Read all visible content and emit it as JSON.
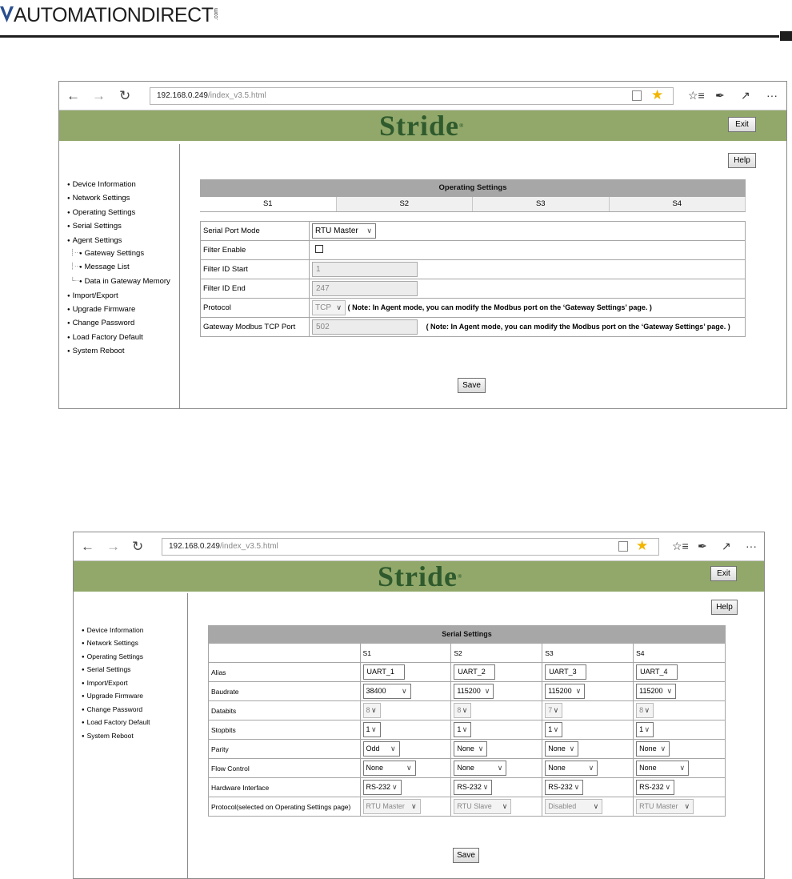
{
  "logo": {
    "text": "AUTOMATIONDIRECT",
    "suffix": ".com"
  },
  "colors": {
    "banner": "#91a86a",
    "brand_green": "#2f5a2d",
    "star": "#f2b500",
    "header_bar": "#a7a7a7"
  },
  "browser": {
    "url_host": "192.168.0.249",
    "url_path": "/index_v3.5.html",
    "icons": [
      "back-arrow-icon",
      "forward-arrow-icon",
      "refresh-icon",
      "reading-view-icon",
      "favorite-star-icon",
      "favorites-list-icon",
      "pen-icon",
      "share-icon",
      "more-icon"
    ]
  },
  "brand": {
    "name": "Stride",
    "mark": "®"
  },
  "buttons": {
    "exit": "Exit",
    "help": "Help",
    "save": "Save"
  },
  "shot1": {
    "sidebar": [
      "Device Information",
      "Network Settings",
      "Operating Settings",
      "Serial Settings",
      "Agent Settings",
      "Gateway Settings",
      "Message List",
      "Data in Gateway Memory",
      "Import/Export",
      "Upgrade Firmware",
      "Change Password",
      "Load Factory Default",
      "System Reboot"
    ],
    "title": "Operating Settings",
    "tabs": [
      "S1",
      "S2",
      "S3",
      "S4"
    ],
    "rows": {
      "serial_port_mode": {
        "label": "Serial Port Mode",
        "value": "RTU Master"
      },
      "filter_enable": {
        "label": "Filter Enable"
      },
      "filter_id_start": {
        "label": "Filter ID Start",
        "value": "1"
      },
      "filter_id_end": {
        "label": "Filter ID End",
        "value": "247"
      },
      "protocol": {
        "label": "Protocol",
        "value": "TCP",
        "note": "( Note: In Agent mode, you can modify the Modbus port on the ‘Gateway Settings’ page. )"
      },
      "gateway_port": {
        "label": "Gateway Modbus TCP Port",
        "value": "502",
        "note": "( Note: In Agent mode, you can modify the Modbus port on the ‘Gateway Settings’ page. )"
      }
    }
  },
  "shot2": {
    "sidebar": [
      "Device Information",
      "Network Settings",
      "Operating Settings",
      "Serial Settings",
      "Import/Export",
      "Upgrade Firmware",
      "Change Password",
      "Load Factory Default",
      "System Reboot"
    ],
    "title": "Serial Settings",
    "columns": [
      "S1",
      "S2",
      "S3",
      "S4"
    ],
    "rows": [
      {
        "label": "Alias",
        "kind": "text",
        "values": [
          "UART_1",
          "UART_2",
          "UART_3",
          "UART_4"
        ]
      },
      {
        "label": "Baudrate",
        "kind": "select",
        "values": [
          "38400",
          "115200",
          "115200",
          "115200"
        ]
      },
      {
        "label": "Databits",
        "kind": "disabled",
        "values": [
          "8",
          "8",
          "7",
          "8"
        ]
      },
      {
        "label": "Stopbits",
        "kind": "select",
        "values": [
          "1",
          "1",
          "1",
          "1"
        ]
      },
      {
        "label": "Parity",
        "kind": "select",
        "values": [
          "Odd",
          "None",
          "None",
          "None"
        ]
      },
      {
        "label": "Flow Control",
        "kind": "select",
        "values": [
          "None",
          "None",
          "None",
          "None"
        ]
      },
      {
        "label": "Hardware Interface",
        "kind": "select",
        "values": [
          "RS-232",
          "RS-232",
          "RS-232",
          "RS-232"
        ]
      },
      {
        "label": "Protocol(selected on Operating Settings page)",
        "kind": "disabled",
        "values": [
          "RTU Master",
          "RTU Slave",
          "Disabled",
          "RTU Master"
        ]
      }
    ]
  }
}
